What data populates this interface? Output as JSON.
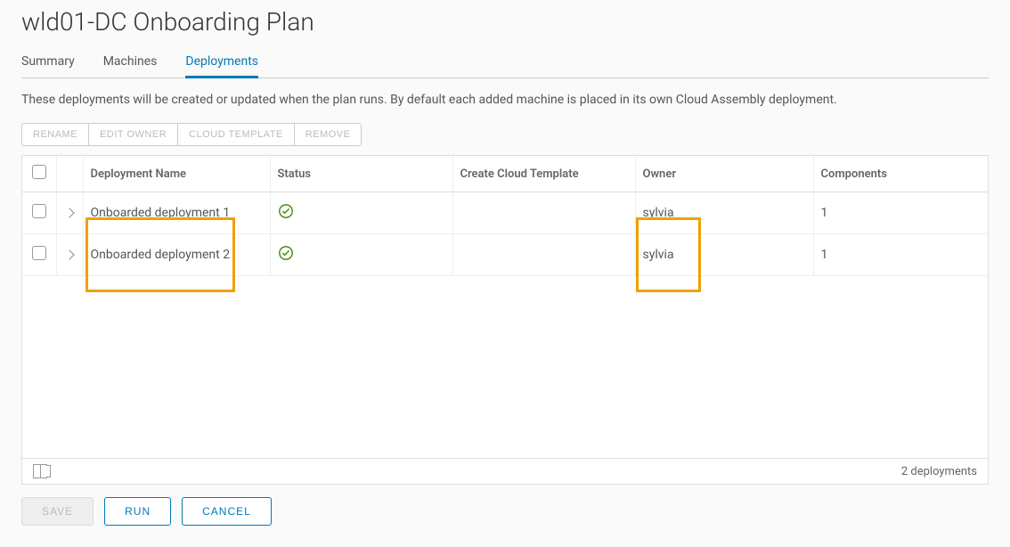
{
  "page_title": "wld01-DC Onboarding Plan",
  "tabs": [
    {
      "label": "Summary",
      "active": false
    },
    {
      "label": "Machines",
      "active": false
    },
    {
      "label": "Deployments",
      "active": true
    }
  ],
  "description": "These deployments will be created or updated when the plan runs. By default each added machine is placed in its own Cloud Assembly deployment.",
  "toolbar_buttons": [
    "RENAME",
    "EDIT OWNER",
    "CLOUD TEMPLATE",
    "REMOVE"
  ],
  "columns": {
    "name": "Deployment Name",
    "status": "Status",
    "template": "Create Cloud Template",
    "owner": "Owner",
    "components": "Components"
  },
  "rows": [
    {
      "name": "Onboarded deployment 1",
      "status": "ok",
      "template": "",
      "owner": "sylvia",
      "components": "1"
    },
    {
      "name": "Onboarded deployment 2",
      "status": "ok",
      "template": "",
      "owner": "sylvia",
      "components": "1"
    }
  ],
  "footer_count": "2 deployments",
  "actions": {
    "save": "SAVE",
    "run": "RUN",
    "cancel": "CANCEL"
  },
  "highlight_color": "#f0a000"
}
